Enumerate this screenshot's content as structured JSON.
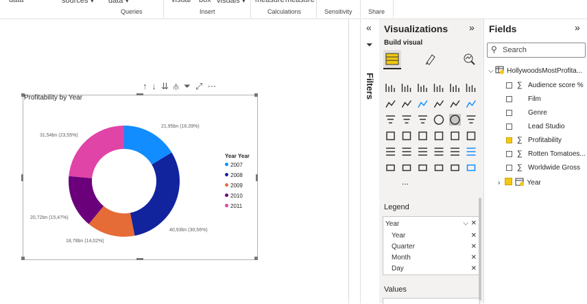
{
  "ribbon": {
    "top_items": [
      "data",
      "sources",
      "data",
      "visual",
      "box",
      "visuals",
      "measure",
      "measure"
    ],
    "groups": [
      "Queries",
      "Insert",
      "Calculations",
      "Sensitivity",
      "Share"
    ]
  },
  "filters": {
    "label": "Filters"
  },
  "visualizations": {
    "title": "Visualizations",
    "build_label": "Build visual",
    "more_label": "...",
    "legend_label": "Legend",
    "legend_field": "Year",
    "legend_subfields": [
      "Year",
      "Quarter",
      "Month",
      "Day"
    ],
    "values_label": "Values"
  },
  "fields": {
    "title": "Fields",
    "search_placeholder": "Search",
    "table_name": "HollywoodsMostProfita...",
    "items": [
      {
        "name": "Audience score %",
        "sigma": true,
        "checked": false
      },
      {
        "name": "Film",
        "sigma": false,
        "checked": false
      },
      {
        "name": "Genre",
        "sigma": false,
        "checked": false
      },
      {
        "name": "Lead Studio",
        "sigma": false,
        "checked": false
      },
      {
        "name": "Profitability",
        "sigma": true,
        "checked": true
      },
      {
        "name": "Rotten Tomatoes...",
        "sigma": true,
        "checked": false
      },
      {
        "name": "Worldwide Gross",
        "sigma": true,
        "checked": false
      }
    ],
    "year_item": "Year"
  },
  "chart_data": {
    "type": "pie",
    "title": "Profitability by Year",
    "legend_title": "Year Year",
    "legend_position": "right",
    "categories": [
      "2007",
      "2008",
      "2009",
      "2010",
      "2011"
    ],
    "values": [
      21.95,
      40.93,
      18.78,
      20.72,
      31.54
    ],
    "labels": [
      "21,95bn (16,39%)",
      "40,93bn (30,56%)",
      "18,78bn (14,02%)",
      "20,72bn (15,47%)",
      "31,54bn (23,55%)"
    ],
    "colors": [
      "#118DFF",
      "#12239E",
      "#E66C37",
      "#6B007B",
      "#E044A7"
    ],
    "donut": true
  }
}
